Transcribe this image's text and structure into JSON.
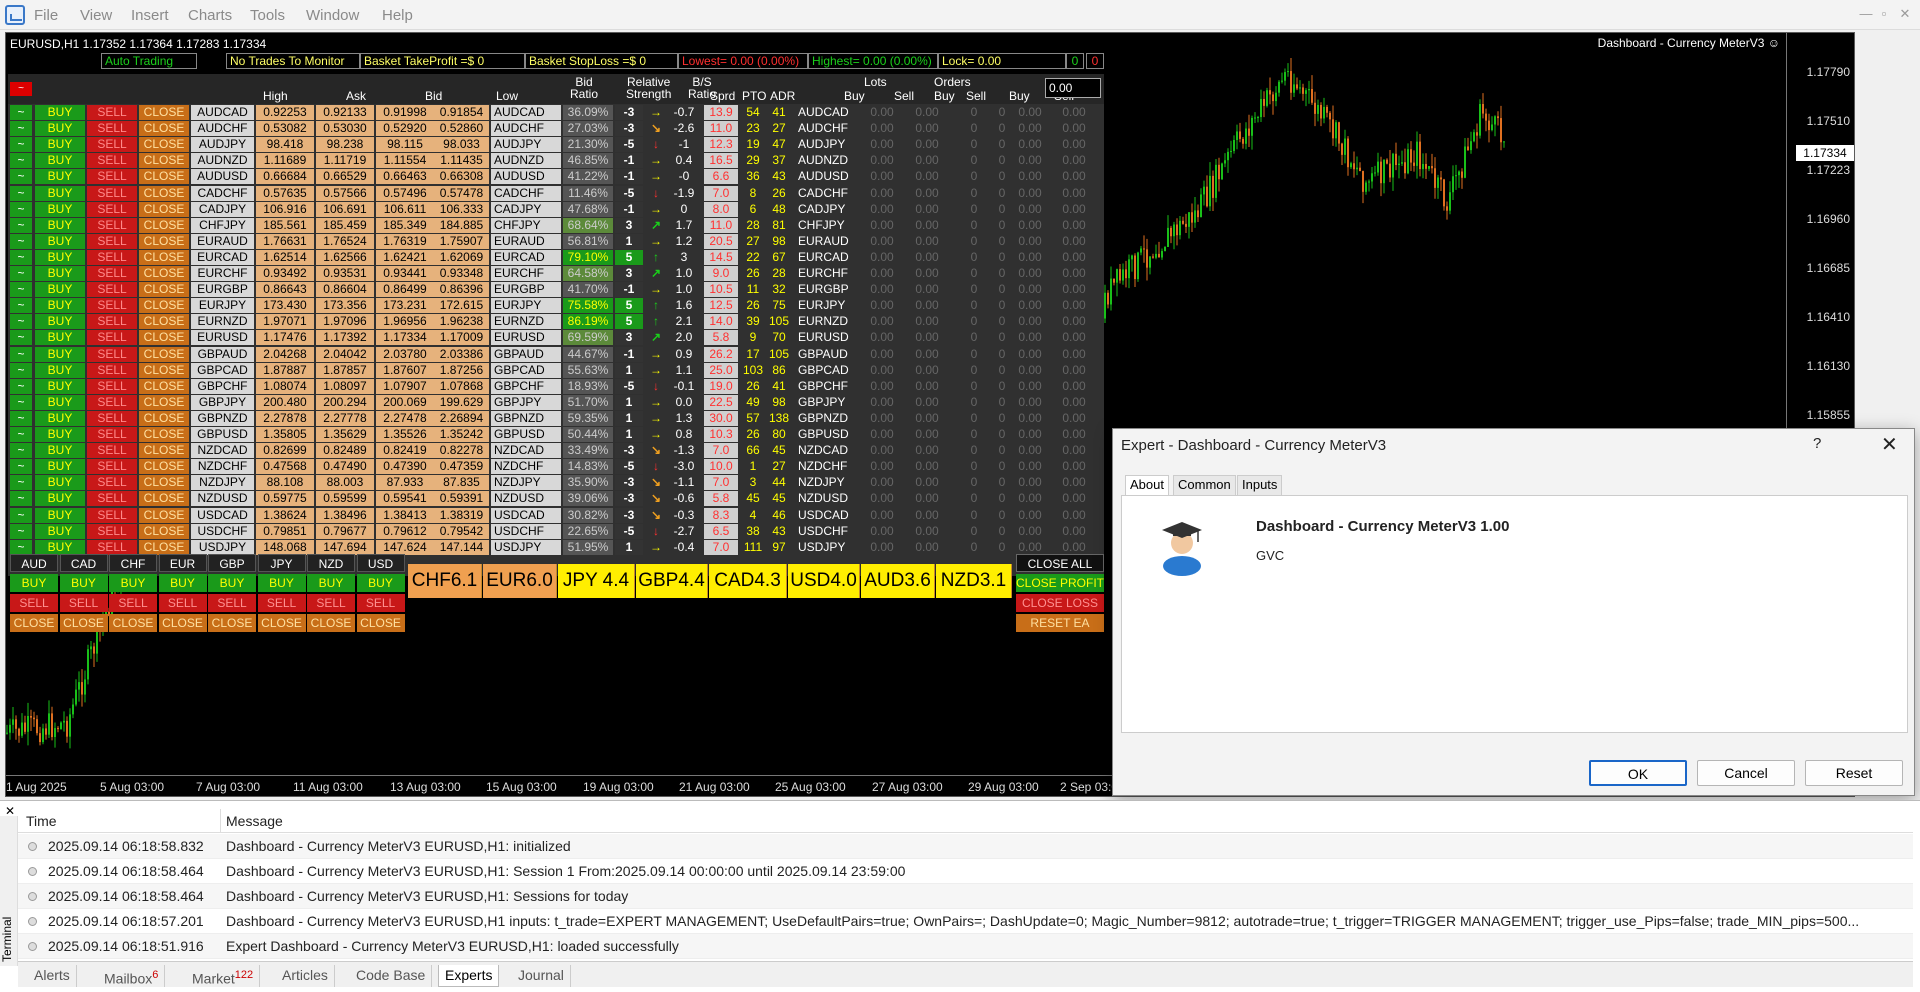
{
  "menu": [
    "File",
    "View",
    "Insert",
    "Charts",
    "Tools",
    "Window",
    "Help"
  ],
  "chart": {
    "symbol_line": "EURUSD,H1  1.17352 1.17364 1.17283 1.17334",
    "ea_title": "Dashboard - Currency MeterV3 ☺",
    "price_labels": [
      "1.17790",
      "1.17510",
      "1.17223",
      "1.16960",
      "1.16685",
      "1.16410",
      "1.16130",
      "1.15855"
    ],
    "current_price": "1.17334",
    "time_labels": [
      "1 Aug 2025",
      "5 Aug 03:00",
      "7 Aug 03:00",
      "11 Aug 03:00",
      "13 Aug 03:00",
      "15 Aug 03:00",
      "19 Aug 03:00",
      "21 Aug 03:00",
      "25 Aug 03:00",
      "27 Aug 03:00",
      "29 Aug 03:00",
      "2 Sep 03:00"
    ],
    "colors": {
      "bull": "#19c019",
      "bear": "#e07020",
      "bg": "#000000"
    }
  },
  "dash": {
    "auto_trading": "Auto Trading",
    "no_trades": "No Trades To Monitor",
    "take_profit": "Basket TakeProfit =$ 0",
    "stop_loss": "Basket StopLoss =$ 0",
    "lowest": "Lowest= 0.00 (0.00%)",
    "highest": "Highest= 0.00 (0.00%)",
    "lock": "Lock= 0.00",
    "zero_a": "0",
    "zero_b": "0",
    "mini_red": "~",
    "input_value": "0.00",
    "headers": {
      "high": "High",
      "ask": "Ask",
      "bid": "Bid",
      "low": "Low",
      "bid_ratio": "Bid\nRatio",
      "rel_strength": "Relative\nStrength",
      "bs_ratio": "B/S\nRatio",
      "spread": "Sprd",
      "pto": "PTO",
      "adr": "ADR",
      "lots": "Lots",
      "orders": "Orders",
      "buy1": "Buy",
      "sell1": "Sell",
      "buy2": "Buy",
      "sell2": "Sell",
      "buy3": "Buy",
      "sell3": "Sell"
    },
    "labels": {
      "toggle": "~",
      "buy": "BUY",
      "sell": "SELL",
      "close": "CLOSE",
      "zero": "0.00",
      "izero": "0"
    },
    "rows": [
      {
        "pair": "AUDCAD",
        "high": "0.92253",
        "ask": "0.92133",
        "bid": "0.91998",
        "low": "0.91854",
        "ratio": "36.09%",
        "rs": "-3",
        "bs": "-0.7",
        "arw": "→",
        "spread": "13.9",
        "pto": "54",
        "adr": "41"
      },
      {
        "pair": "AUDCHF",
        "high": "0.53082",
        "ask": "0.53030",
        "bid": "0.52920",
        "low": "0.52860",
        "ratio": "27.03%",
        "rs": "-3",
        "bs": "-2.6",
        "arw": "↘",
        "spread": "11.0",
        "pto": "23",
        "adr": "27"
      },
      {
        "pair": "AUDJPY",
        "high": "98.418",
        "ask": "98.238",
        "bid": "98.115",
        "low": "98.033",
        "ratio": "21.30%",
        "rs": "-5",
        "bs": "-1",
        "arw": "↓",
        "spread": "12.3",
        "pto": "19",
        "adr": "47"
      },
      {
        "pair": "AUDNZD",
        "high": "1.11689",
        "ask": "1.11719",
        "bid": "1.11554",
        "low": "1.11435",
        "ratio": "46.85%",
        "rs": "-1",
        "bs": "0.4",
        "arw": "→",
        "spread": "16.5",
        "pto": "29",
        "adr": "37"
      },
      {
        "pair": "AUDUSD",
        "high": "0.66684",
        "ask": "0.66529",
        "bid": "0.66463",
        "low": "0.66308",
        "ratio": "41.22%",
        "rs": "-1",
        "bs": "-0",
        "arw": "→",
        "spread": "6.6",
        "pto": "36",
        "adr": "43"
      },
      {
        "pair": "CADCHF",
        "high": "0.57635",
        "ask": "0.57566",
        "bid": "0.57496",
        "low": "0.57478",
        "ratio": "11.46%",
        "rs": "-5",
        "bs": "-1.9",
        "arw": "↓",
        "spread": "7.0",
        "pto": "8",
        "adr": "26"
      },
      {
        "pair": "CADJPY",
        "high": "106.916",
        "ask": "106.691",
        "bid": "106.611",
        "low": "106.333",
        "ratio": "47.68%",
        "rs": "-1",
        "bs": "0",
        "arw": "→",
        "spread": "8.0",
        "pto": "6",
        "adr": "48"
      },
      {
        "pair": "CHFJPY",
        "high": "185.561",
        "ask": "185.459",
        "bid": "185.349",
        "low": "184.885",
        "ratio": "68.64%",
        "rs": "3",
        "bs": "1.7",
        "arw": "↗",
        "spread": "11.0",
        "pto": "28",
        "adr": "81"
      },
      {
        "pair": "EURAUD",
        "high": "1.76631",
        "ask": "1.76524",
        "bid": "1.76319",
        "low": "1.75907",
        "ratio": "56.81%",
        "rs": "1",
        "bs": "1.2",
        "arw": "→",
        "spread": "20.5",
        "pto": "27",
        "adr": "98"
      },
      {
        "pair": "EURCAD",
        "high": "1.62514",
        "ask": "1.62566",
        "bid": "1.62421",
        "low": "1.62069",
        "ratio": "79.10%",
        "rs": "5",
        "bs": "3",
        "arw": "↑",
        "spread": "14.5",
        "pto": "22",
        "adr": "67"
      },
      {
        "pair": "EURCHF",
        "high": "0.93492",
        "ask": "0.93531",
        "bid": "0.93441",
        "low": "0.93348",
        "ratio": "64.58%",
        "rs": "3",
        "bs": "1.0",
        "arw": "↗",
        "spread": "9.0",
        "pto": "26",
        "adr": "28"
      },
      {
        "pair": "EURGBP",
        "high": "0.86643",
        "ask": "0.86604",
        "bid": "0.86499",
        "low": "0.86396",
        "ratio": "41.70%",
        "rs": "-1",
        "bs": "1.0",
        "arw": "→",
        "spread": "10.5",
        "pto": "11",
        "adr": "32"
      },
      {
        "pair": "EURJPY",
        "high": "173.430",
        "ask": "173.356",
        "bid": "173.231",
        "low": "172.615",
        "ratio": "75.58%",
        "rs": "5",
        "bs": "1.6",
        "arw": "↑",
        "spread": "12.5",
        "pto": "26",
        "adr": "75"
      },
      {
        "pair": "EURNZD",
        "high": "1.97071",
        "ask": "1.97096",
        "bid": "1.96956",
        "low": "1.96238",
        "ratio": "86.19%",
        "rs": "5",
        "bs": "2.1",
        "arw": "↑",
        "spread": "14.0",
        "pto": "39",
        "adr": "105"
      },
      {
        "pair": "EURUSD",
        "high": "1.17476",
        "ask": "1.17392",
        "bid": "1.17334",
        "low": "1.17009",
        "ratio": "69.59%",
        "rs": "3",
        "bs": "2.0",
        "arw": "↗",
        "spread": "5.8",
        "pto": "9",
        "adr": "70"
      },
      {
        "pair": "GBPAUD",
        "high": "2.04268",
        "ask": "2.04042",
        "bid": "2.03780",
        "low": "2.03386",
        "ratio": "44.67%",
        "rs": "-1",
        "bs": "0.9",
        "arw": "→",
        "spread": "26.2",
        "pto": "17",
        "adr": "105"
      },
      {
        "pair": "GBPCAD",
        "high": "1.87887",
        "ask": "1.87857",
        "bid": "1.87607",
        "low": "1.87256",
        "ratio": "55.63%",
        "rs": "1",
        "bs": "1.1",
        "arw": "→",
        "spread": "25.0",
        "pto": "103",
        "adr": "86"
      },
      {
        "pair": "GBPCHF",
        "high": "1.08074",
        "ask": "1.08097",
        "bid": "1.07907",
        "low": "1.07868",
        "ratio": "18.93%",
        "rs": "-5",
        "bs": "-0.1",
        "arw": "↓",
        "spread": "19.0",
        "pto": "26",
        "adr": "41"
      },
      {
        "pair": "GBPJPY",
        "high": "200.480",
        "ask": "200.294",
        "bid": "200.069",
        "low": "199.629",
        "ratio": "51.70%",
        "rs": "1",
        "bs": "0.0",
        "arw": "→",
        "spread": "22.5",
        "pto": "49",
        "adr": "98"
      },
      {
        "pair": "GBPNZD",
        "high": "2.27878",
        "ask": "2.27778",
        "bid": "2.27478",
        "low": "2.26894",
        "ratio": "59.35%",
        "rs": "1",
        "bs": "1.3",
        "arw": "→",
        "spread": "30.0",
        "pto": "57",
        "adr": "138"
      },
      {
        "pair": "GBPUSD",
        "high": "1.35805",
        "ask": "1.35629",
        "bid": "1.35526",
        "low": "1.35242",
        "ratio": "50.44%",
        "rs": "1",
        "bs": "0.8",
        "arw": "→",
        "spread": "10.3",
        "pto": "26",
        "adr": "80"
      },
      {
        "pair": "NZDCAD",
        "high": "0.82699",
        "ask": "0.82489",
        "bid": "0.82419",
        "low": "0.82278",
        "ratio": "33.49%",
        "rs": "-3",
        "bs": "-1.3",
        "arw": "↘",
        "spread": "7.0",
        "pto": "66",
        "adr": "45"
      },
      {
        "pair": "NZDCHF",
        "high": "0.47568",
        "ask": "0.47490",
        "bid": "0.47390",
        "low": "0.47359",
        "ratio": "14.83%",
        "rs": "-5",
        "bs": "-3.0",
        "arw": "↓",
        "spread": "10.0",
        "pto": "1",
        "adr": "27"
      },
      {
        "pair": "NZDJPY",
        "high": "88.108",
        "ask": "88.003",
        "bid": "87.933",
        "low": "87.835",
        "ratio": "35.90%",
        "rs": "-3",
        "bs": "-1.1",
        "arw": "↘",
        "spread": "7.0",
        "pto": "3",
        "adr": "44"
      },
      {
        "pair": "NZDUSD",
        "high": "0.59775",
        "ask": "0.59599",
        "bid": "0.59541",
        "low": "0.59391",
        "ratio": "39.06%",
        "rs": "-3",
        "bs": "-0.6",
        "arw": "↘",
        "spread": "5.8",
        "pto": "45",
        "adr": "45"
      },
      {
        "pair": "USDCAD",
        "high": "1.38624",
        "ask": "1.38496",
        "bid": "1.38413",
        "low": "1.38319",
        "ratio": "30.82%",
        "rs": "-3",
        "bs": "-0.3",
        "arw": "↘",
        "spread": "8.3",
        "pto": "4",
        "adr": "46"
      },
      {
        "pair": "USDCHF",
        "high": "0.79851",
        "ask": "0.79677",
        "bid": "0.79612",
        "low": "0.79542",
        "ratio": "22.65%",
        "rs": "-5",
        "bs": "-2.7",
        "arw": "↓",
        "spread": "6.5",
        "pto": "38",
        "adr": "43"
      },
      {
        "pair": "USDJPY",
        "high": "148.068",
        "ask": "147.694",
        "bid": "147.624",
        "low": "147.144",
        "ratio": "51.95%",
        "rs": "1",
        "bs": "-0.4",
        "arw": "→",
        "spread": "7.0",
        "pto": "111",
        "adr": "97"
      }
    ],
    "currencies": [
      "AUD",
      "CAD",
      "CHF",
      "EUR",
      "GBP",
      "JPY",
      "NZD",
      "USD"
    ],
    "strength": [
      {
        "label": "CHF6.1",
        "color": "#f0a050"
      },
      {
        "label": "EUR6.0",
        "color": "#f0a050"
      },
      {
        "label": "JPY 4.4",
        "color": "#ffee00"
      },
      {
        "label": "GBP4.4",
        "color": "#ffee00"
      },
      {
        "label": "CAD4.3",
        "color": "#ffee00"
      },
      {
        "label": "USD4.0",
        "color": "#ffee00"
      },
      {
        "label": "AUD3.6",
        "color": "#ffee00"
      },
      {
        "label": "NZD3.1",
        "color": "#ffee00"
      }
    ],
    "right_buttons": {
      "close_all": "CLOSE ALL",
      "close_profit": "CLOSE PROFIT",
      "close_loss": "CLOSE LOSS",
      "reset_ea": "RESET EA"
    }
  },
  "dialog": {
    "title": "Expert - Dashboard - Currency MeterV3",
    "help": "?",
    "close": "✕",
    "tabs": [
      "About",
      "Common",
      "Inputs"
    ],
    "name": "Dashboard - Currency MeterV3 1.00",
    "author": "GVC",
    "ok": "OK",
    "cancel": "Cancel",
    "reset": "Reset"
  },
  "terminal": {
    "close": "✕",
    "side_label": "Terminal",
    "col_time": "Time",
    "col_message": "Message",
    "logs": [
      {
        "time": "2025.09.14 06:18:58.832",
        "msg": "Dashboard - Currency MeterV3 EURUSD,H1: initialized"
      },
      {
        "time": "2025.09.14 06:18:58.464",
        "msg": "Dashboard - Currency MeterV3 EURUSD,H1: Session 1 From:2025.09.14 00:00:00 until 2025.09.14 23:59:00"
      },
      {
        "time": "2025.09.14 06:18:58.464",
        "msg": "Dashboard - Currency MeterV3 EURUSD,H1: Sessions for today"
      },
      {
        "time": "2025.09.14 06:18:57.201",
        "msg": "Dashboard - Currency MeterV3 EURUSD,H1 inputs: t_trade=EXPERT MANAGEMENT; UseDefaultPairs=true; OwnPairs=; DashUpdate=0; Magic_Number=9812; autotrade=true; t_trigger=TRIGGER MANAGEMENT; trigger_use_Pips=false; trade_MIN_pips=500..."
      },
      {
        "time": "2025.09.14 06:18:51.916",
        "msg": "Expert Dashboard - Currency MeterV3 EURUSD,H1: loaded successfully"
      }
    ],
    "tabs": [
      {
        "label": "Alerts",
        "badge": ""
      },
      {
        "label": "Mailbox",
        "badge": "6"
      },
      {
        "label": "Market",
        "badge": "122"
      },
      {
        "label": "Articles",
        "badge": ""
      },
      {
        "label": "Code Base",
        "badge": ""
      },
      {
        "label": "Experts",
        "badge": ""
      },
      {
        "label": "Journal",
        "badge": ""
      }
    ]
  }
}
